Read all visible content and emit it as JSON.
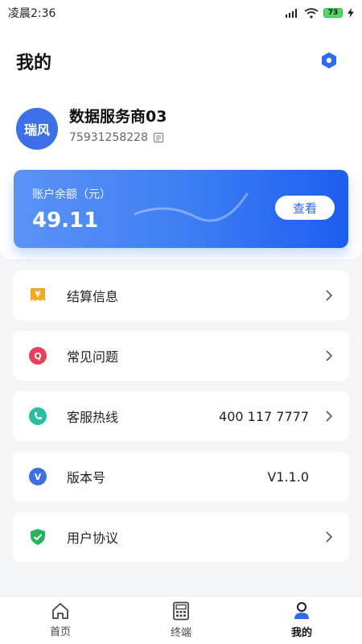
{
  "status_bar": {
    "time": "凌晨2:36",
    "battery": "73"
  },
  "page": {
    "title": "我的"
  },
  "profile": {
    "avatar_text": "瑞风",
    "name": "数据服务商03",
    "id": "75931258228"
  },
  "balance": {
    "label": "账户余额（元）",
    "value": "49.11",
    "button_label": "查看"
  },
  "menu": [
    {
      "label": "结算信息",
      "value": "",
      "icon": "settlement-icon",
      "chevron": true
    },
    {
      "label": "常见问题",
      "value": "",
      "icon": "faq-icon",
      "chevron": true
    },
    {
      "label": "客服热线",
      "value": "400 117 7777",
      "icon": "phone-icon",
      "chevron": true
    },
    {
      "label": "版本号",
      "value": "V1.1.0",
      "icon": "version-icon",
      "chevron": false
    },
    {
      "label": "用户协议",
      "value": "",
      "icon": "shield-icon",
      "chevron": true
    }
  ],
  "nav": [
    {
      "label": "首页",
      "icon": "home-icon",
      "active": false
    },
    {
      "label": "终端",
      "icon": "terminal-icon",
      "active": false
    },
    {
      "label": "我的",
      "icon": "user-icon",
      "active": true
    }
  ],
  "colors": {
    "accent": "#2f6bf0",
    "settlement": "#f5a623",
    "faq": "#e8405a",
    "phone": "#26bfa0",
    "version": "#3d6fe8",
    "agreement": "#26b35a"
  }
}
